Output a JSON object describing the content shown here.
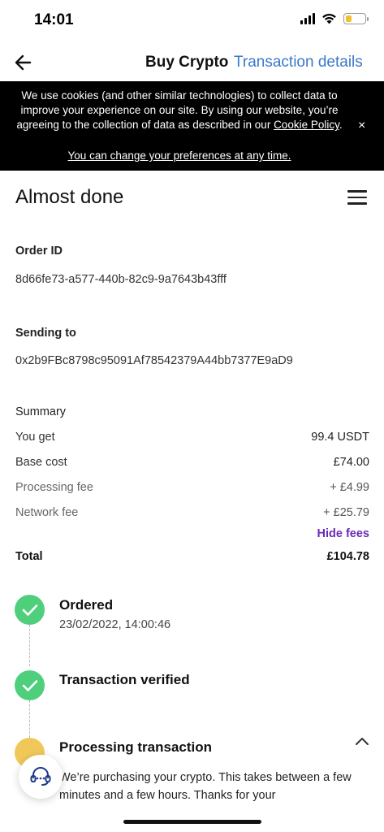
{
  "status_bar": {
    "time": "14:01"
  },
  "nav": {
    "title": "Buy Crypto",
    "link": "Transaction details"
  },
  "cookie_banner": {
    "text_before": "We use cookies (and other similar technologies) to collect data to improve your experience on our site. By using our website, you’re agreeing to the collection of data as described in our ",
    "policy_link": "Cookie Policy",
    "text_after": ".",
    "preferences_link": "You can change your preferences at any time.",
    "close_symbol": "×"
  },
  "page": {
    "title": "Almost done"
  },
  "order": {
    "label": "Order ID",
    "value": "8d66fe73-a577-440b-82c9-9a7643b43fff"
  },
  "recipient": {
    "label": "Sending to",
    "value": "0x2b9FBc8798c95091Af78542379A44bb7377E9aD9"
  },
  "summary": {
    "label": "Summary",
    "rows": [
      {
        "key": "You get",
        "value": "99.4 USDT"
      },
      {
        "key": "Base cost",
        "value": "£74.00"
      },
      {
        "key": "Processing fee",
        "value": "+ £4.99"
      },
      {
        "key": "Network fee",
        "value": "+ £25.79"
      }
    ],
    "hide_fees": "Hide fees",
    "total_label": "Total",
    "total_value": "£104.78"
  },
  "timeline": {
    "steps": [
      {
        "title": "Ordered",
        "subtitle": "23/02/2022, 14:00:46",
        "status": "done"
      },
      {
        "title": "Transaction verified",
        "status": "done"
      },
      {
        "title": "Processing transaction",
        "status": "pending",
        "description": "We’re purchasing your crypto. This takes between a few minutes and a few hours. Thanks for your"
      }
    ]
  },
  "colors": {
    "accent_purple": "#6a2bb8",
    "link_blue": "#3a78c9",
    "success_green": "#4fcf7c",
    "pending_yellow": "#f0c85a"
  },
  "icons": {
    "back": "arrow-left-icon",
    "menu": "hamburger-menu-icon",
    "support": "headset-icon",
    "check": "check-icon",
    "collapse": "chevron-up-icon"
  }
}
